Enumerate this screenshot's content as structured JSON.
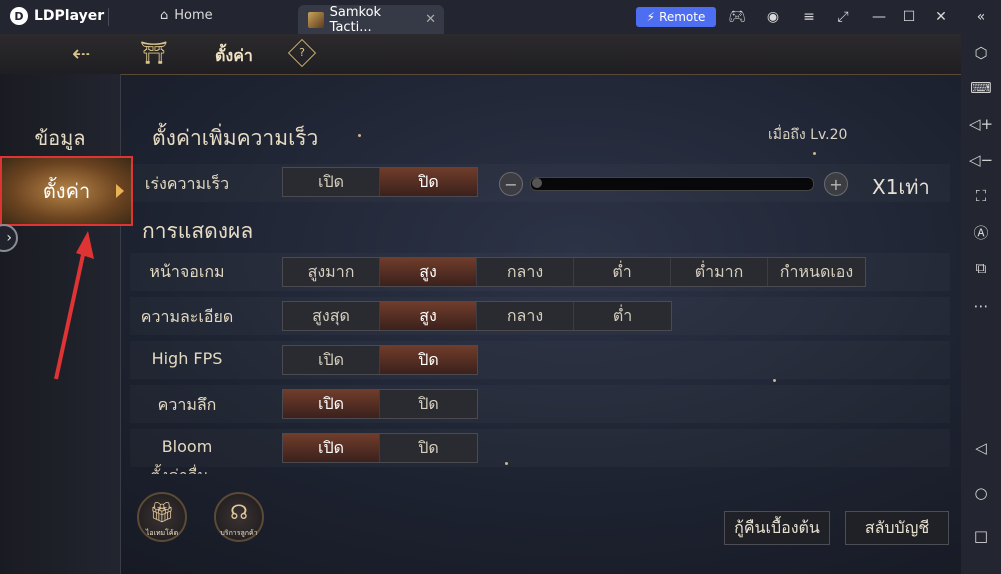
{
  "titlebar": {
    "app_name": "LDPlayer",
    "home_tab": "Home",
    "active_tab": "Samkok Tacti...",
    "remote_label": "Remote"
  },
  "game": {
    "nav_title": "ตั้งค่า",
    "sidebar": {
      "items": [
        "ข้อมูล",
        "ตั้งค่า"
      ],
      "active_index": 1
    },
    "speed_section": {
      "title": "ตั้งค่าเพิ่มความเร็ว",
      "unlock_note": "เมื่อถึง Lv.20",
      "row_label": "เร่งความเร็ว",
      "options": [
        "เปิด",
        "ปิด"
      ],
      "selected": "ปิด",
      "multiplier": "X1เท่า",
      "slider_value": 0
    },
    "display_section": {
      "title": "การแสดงผล",
      "rows": [
        {
          "label": "หน้าจอเกม",
          "options": [
            "สูงมาก",
            "สูง",
            "กลาง",
            "ต่ำ",
            "ต่ำมาก",
            "กำหนดเอง"
          ],
          "selected": "สูง"
        },
        {
          "label": "ความละเอียด",
          "options": [
            "สูงสุด",
            "สูง",
            "กลาง",
            "ต่ำ"
          ],
          "selected": "สูง"
        },
        {
          "label": "High FPS",
          "options": [
            "เปิด",
            "ปิด"
          ],
          "selected": "ปิด"
        },
        {
          "label": "ความลึก",
          "options": [
            "เปิด",
            "ปิด"
          ],
          "selected": "เปิด"
        },
        {
          "label": "Bloom",
          "options": [
            "เปิด",
            "ปิด"
          ],
          "selected": "เปิด"
        }
      ]
    },
    "partial_section_title": "ตั้งค่าอื่น",
    "round_buttons": [
      {
        "caption": "ไอเทมโค้ด",
        "icon": "gift-icon"
      },
      {
        "caption": "บริการลูกค้า",
        "icon": "headset-icon"
      }
    ],
    "bottom_buttons": [
      "กู้คืนเบื้องต้น",
      "สลับบัญชี"
    ]
  },
  "colors": {
    "accent_red": "#e03434",
    "remote_blue": "#4e6ef2",
    "gold": "#d9c38c"
  }
}
